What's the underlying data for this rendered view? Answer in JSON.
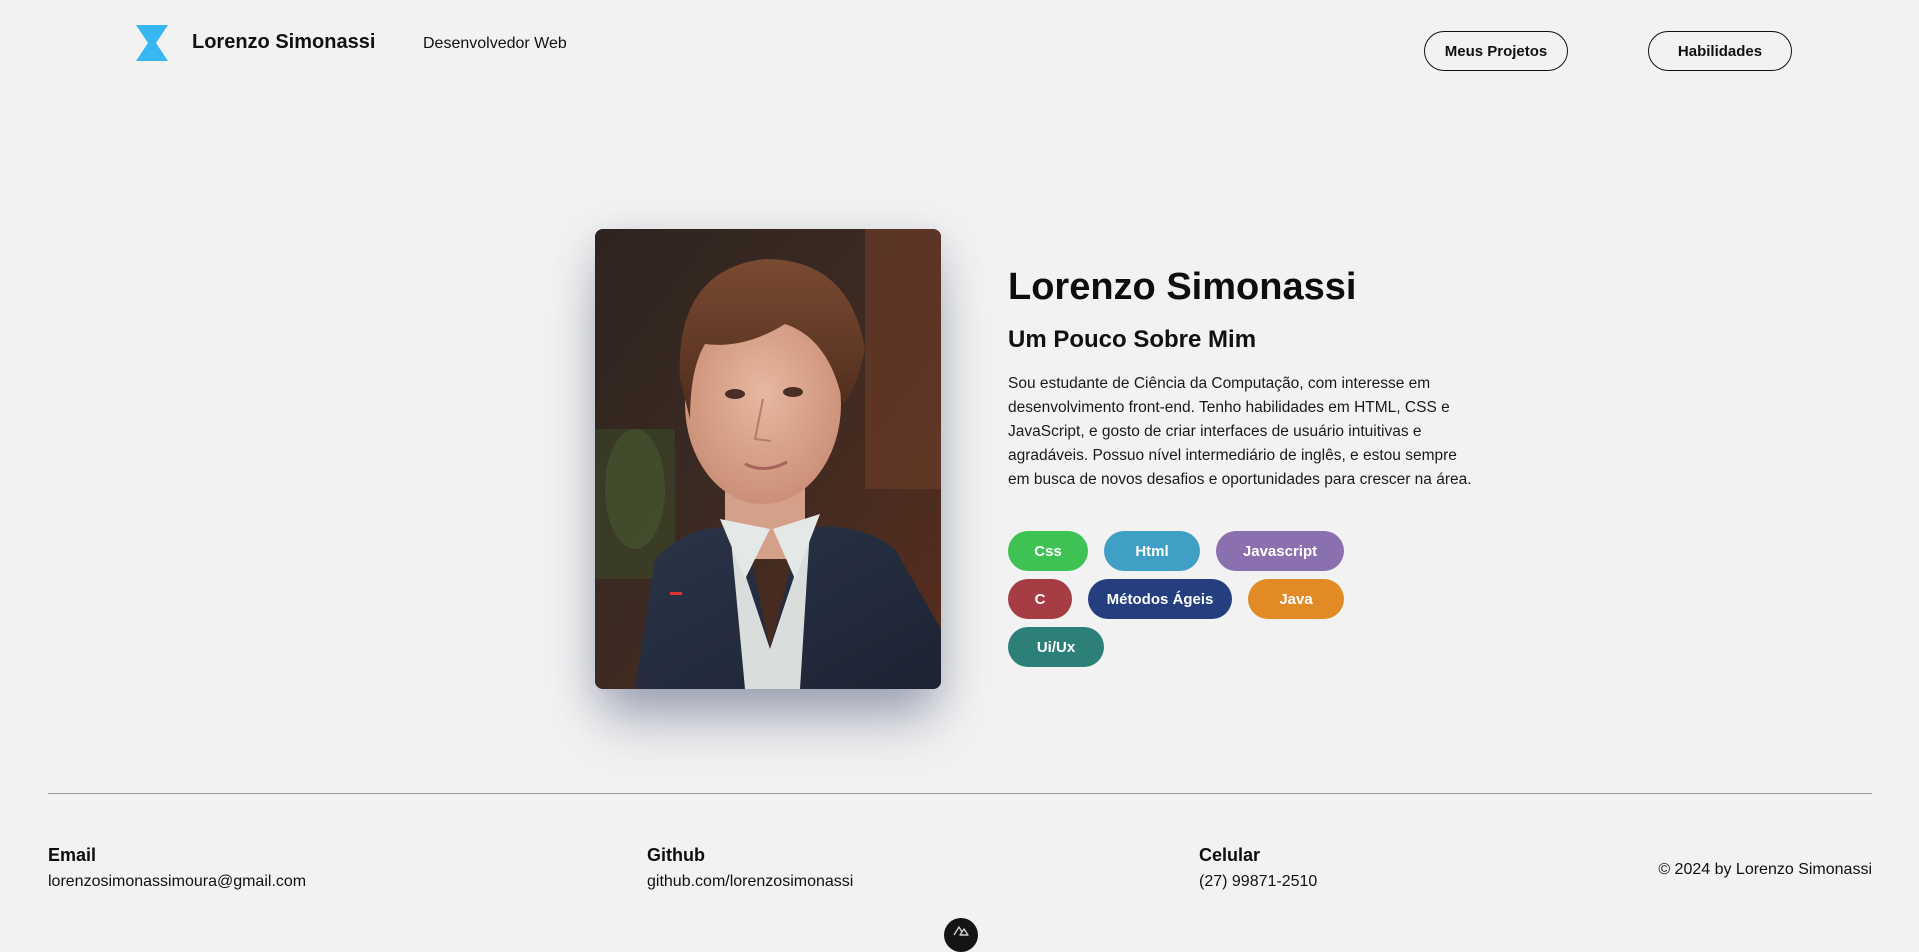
{
  "header": {
    "brand_name": "Lorenzo Simonassi",
    "subtitle": "Desenvolvedor Web",
    "logo_icon": "hourglass-logo-icon",
    "logo_color": "#38b6f1",
    "nav": {
      "projects_label": "Meus Projetos",
      "skills_label": "Habilidades"
    }
  },
  "about": {
    "photo_alt": "Lorenzo Simonassi",
    "name": "Lorenzo Simonassi",
    "heading": "Um Pouco Sobre Mim",
    "text": "Sou estudante de Ciência da Computação, com interesse em desenvolvimento front-end. Tenho habilidades em HTML, CSS e JavaScript, e gosto de criar interfaces de usuário intuitivas e agradáveis. Possuo nível intermediário de inglês, e estou sempre em busca de novos desafios e oportunidades para crescer na área.",
    "skills": [
      [
        {
          "label": "Css",
          "color": "#3ec253"
        },
        {
          "label": "Html",
          "color": "#3f9fc4"
        },
        {
          "label": "Javascript",
          "color": "#8b70b0"
        }
      ],
      [
        {
          "label": "C",
          "color": "#a63d45"
        },
        {
          "label": "Métodos Ágeis",
          "color": "#243e7e"
        },
        {
          "label": "Java",
          "color": "#e28a26"
        }
      ],
      [
        {
          "label": "Ui/Ux",
          "color": "#2c8078"
        }
      ]
    ]
  },
  "footer": {
    "email": {
      "label": "Email",
      "value": "lorenzosimonassimoura@gmail.com"
    },
    "github": {
      "label": "Github",
      "value": "github.com/lorenzosimonassi"
    },
    "phone": {
      "label": "Celular",
      "value": "(27) 99871-2510"
    },
    "copyright": "© 2024  by Lorenzo Simonassi",
    "badge_icon": "nuxt-devtools-icon"
  }
}
